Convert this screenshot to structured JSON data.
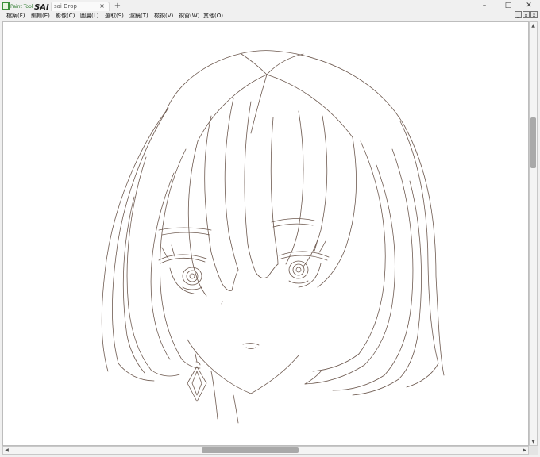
{
  "app": {
    "logo_text": "PaintTool SAI",
    "tab_title": "sai Drop",
    "tab_close": "×",
    "new_tab": "+"
  },
  "window_controls": {
    "minimize": "–",
    "maximize": "□",
    "close": "✕"
  },
  "menu": {
    "items": [
      "檔案(F)",
      "編輯(E)",
      "影像(C)",
      "圖層(L)",
      "選取(S)",
      "濾鏡(T)",
      "檢視(V)",
      "視窗(W)",
      "其他(O)"
    ]
  },
  "mdi_controls": {
    "minimize": "_",
    "restore": "▫",
    "close": "x"
  },
  "canvas": {
    "content": "line-art-drawing",
    "line_color": "#6e5a50"
  },
  "scrollbars": {
    "up": "▲",
    "down": "▼",
    "left": "◀",
    "right": "▶"
  },
  "icons": {
    "logo": "paint-tool-sai-logo",
    "close": "close-icon",
    "add": "plus-icon"
  }
}
